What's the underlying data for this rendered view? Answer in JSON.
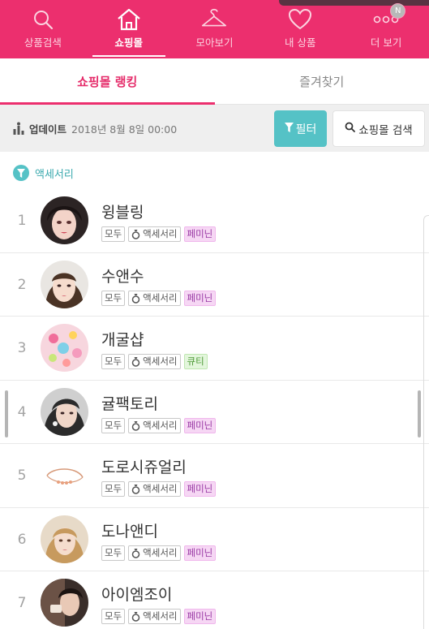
{
  "nav": {
    "items": [
      {
        "label": "상품검색",
        "icon": "search-icon"
      },
      {
        "label": "쇼핑몰",
        "icon": "home-icon"
      },
      {
        "label": "모아보기",
        "icon": "hanger-icon"
      },
      {
        "label": "내 상품",
        "icon": "heart-icon"
      },
      {
        "label": "더 보기",
        "icon": "more-icon"
      }
    ],
    "active_index": 1,
    "badge": "N"
  },
  "tabs": [
    {
      "label": "쇼핑몰 랭킹",
      "active": true
    },
    {
      "label": "즐겨찾기",
      "active": false
    }
  ],
  "update": {
    "label": "업데이트",
    "date": "2018년 8월 8일 00:00"
  },
  "buttons": {
    "filter": "필터",
    "shop_search": "쇼핑몰 검색"
  },
  "category": {
    "label": "액세서리"
  },
  "shops": [
    {
      "rank": "1",
      "name": "윙블링",
      "age": "모두",
      "category": "액세서리",
      "style": "페미닌"
    },
    {
      "rank": "2",
      "name": "수앤수",
      "age": "모두",
      "category": "액세서리",
      "style": "페미닌"
    },
    {
      "rank": "3",
      "name": "개굴샵",
      "age": "모두",
      "category": "액세서리",
      "style": "큐티"
    },
    {
      "rank": "4",
      "name": "귤팩토리",
      "age": "모두",
      "category": "액세서리",
      "style": "페미닌"
    },
    {
      "rank": "5",
      "name": "도로시쥬얼리",
      "age": "모두",
      "category": "액세서리",
      "style": "페미닌"
    },
    {
      "rank": "6",
      "name": "도나앤디",
      "age": "모두",
      "category": "액세서리",
      "style": "페미닌"
    },
    {
      "rank": "7",
      "name": "아이엠조이",
      "age": "모두",
      "category": "액세서리",
      "style": "페미닌"
    }
  ],
  "colors": {
    "brand_pink": "#ec2f6e",
    "teal": "#55c2c6",
    "feminine_tag": "#f6d7f4",
    "cute_tag": "#e3f6dc"
  }
}
